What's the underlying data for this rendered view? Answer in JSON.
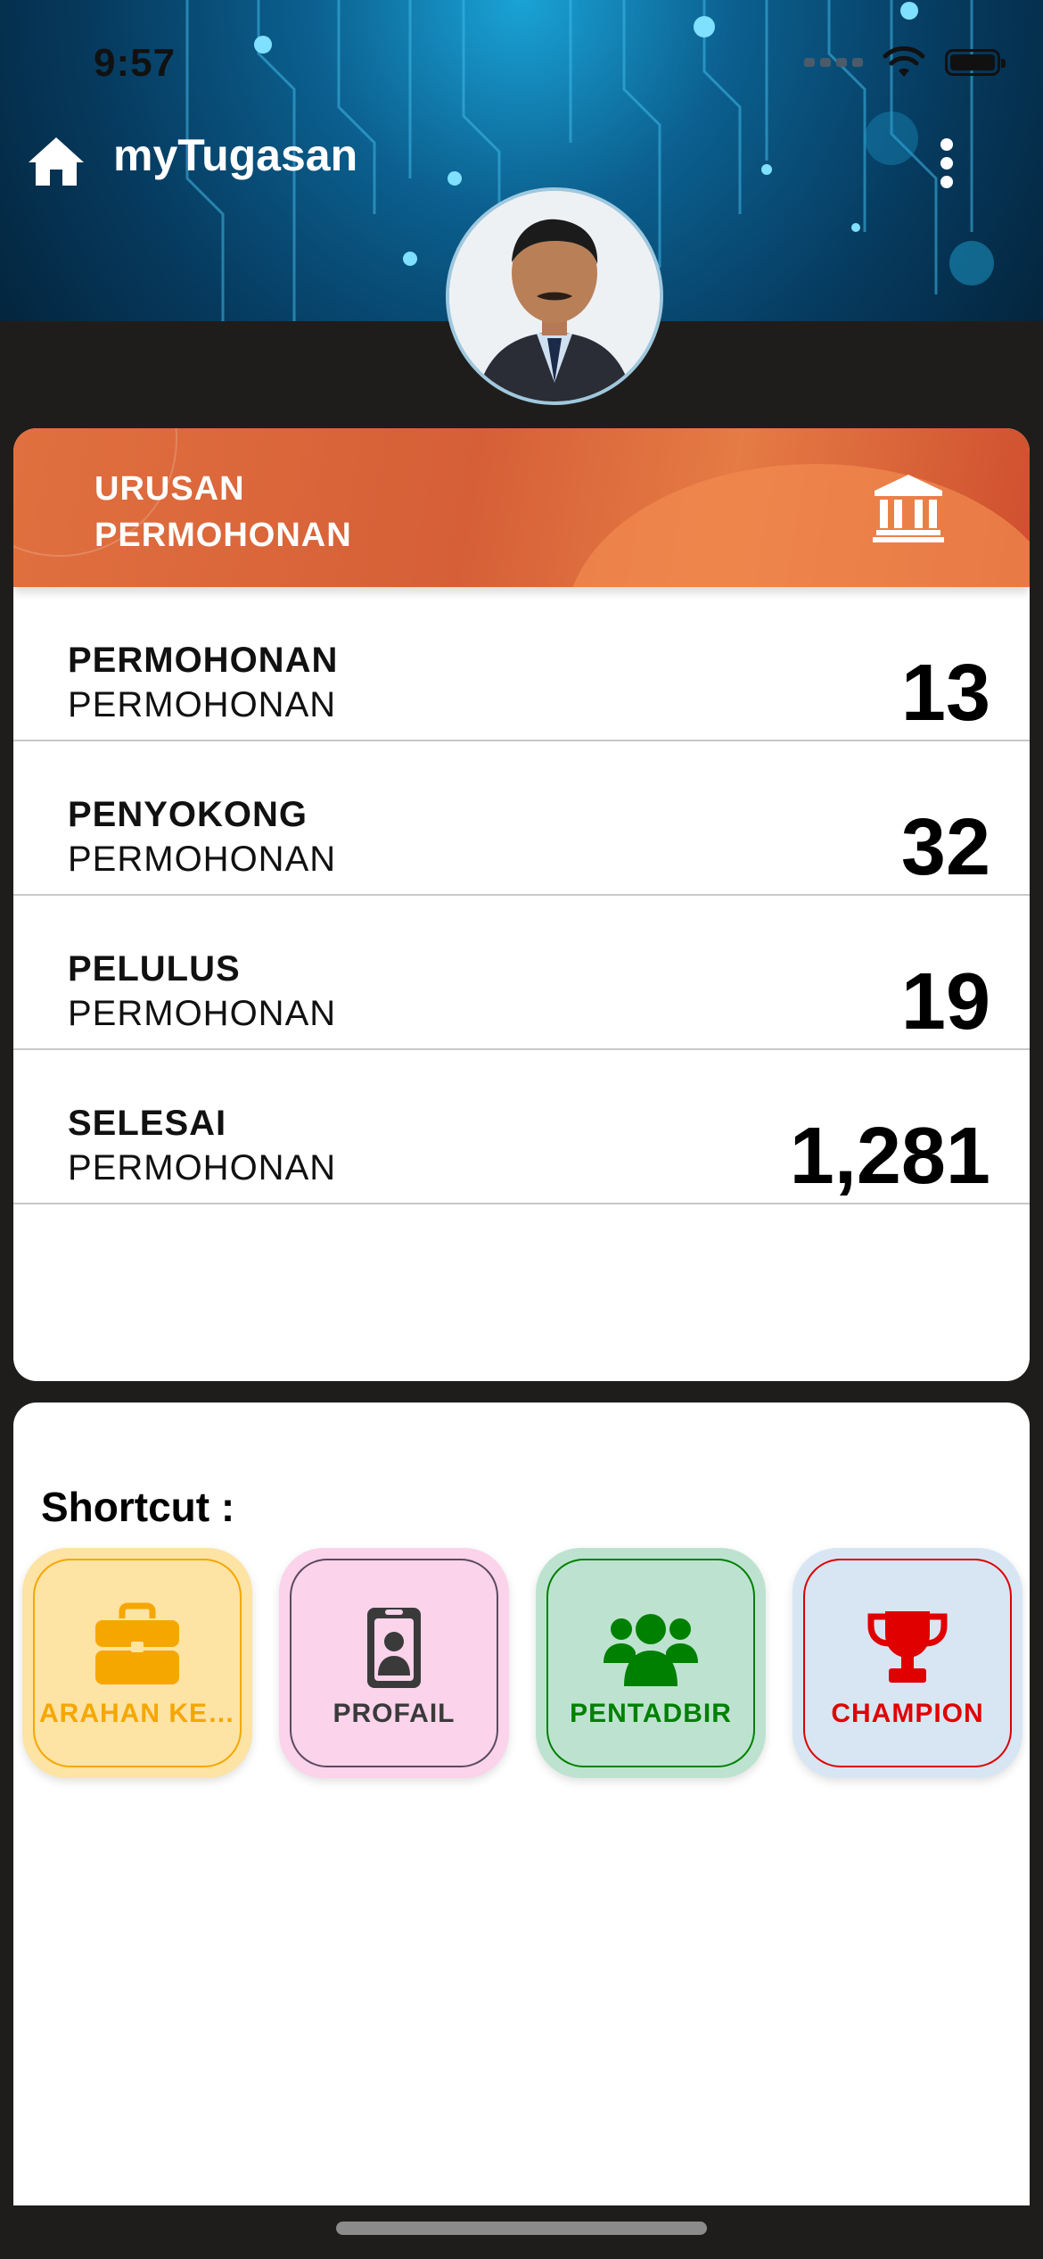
{
  "status_bar": {
    "time": "9:57"
  },
  "header": {
    "title": "myTugasan"
  },
  "urusan": {
    "banner_title_line1": "URUSAN",
    "banner_title_line2": "PERMOHONAN",
    "rows": [
      {
        "label": "PERMOHONAN",
        "sub": "PERMOHONAN",
        "value": "13"
      },
      {
        "label": "PENYOKONG",
        "sub": "PERMOHONAN",
        "value": "32"
      },
      {
        "label": "PELULUS",
        "sub": "PERMOHONAN",
        "value": "19"
      },
      {
        "label": "SELESAI",
        "sub": "PERMOHONAN",
        "value": "1,281"
      }
    ]
  },
  "shortcut": {
    "title": "Shortcut :",
    "tiles": [
      {
        "label": "ARAHAN KERJA",
        "icon": "briefcase-icon",
        "color": "#f5a700",
        "bg": "#fde3a4"
      },
      {
        "label": "PROFAIL",
        "icon": "id-badge-icon",
        "color": "#3a3a3a",
        "bg": "#fbd3ea"
      },
      {
        "label": "PENTADBIR",
        "icon": "users-icon",
        "color": "#008000",
        "bg": "#bde3d0"
      },
      {
        "label": "CHAMPION",
        "icon": "trophy-icon",
        "color": "#e00000",
        "bg": "#d8e6f4"
      }
    ]
  }
}
